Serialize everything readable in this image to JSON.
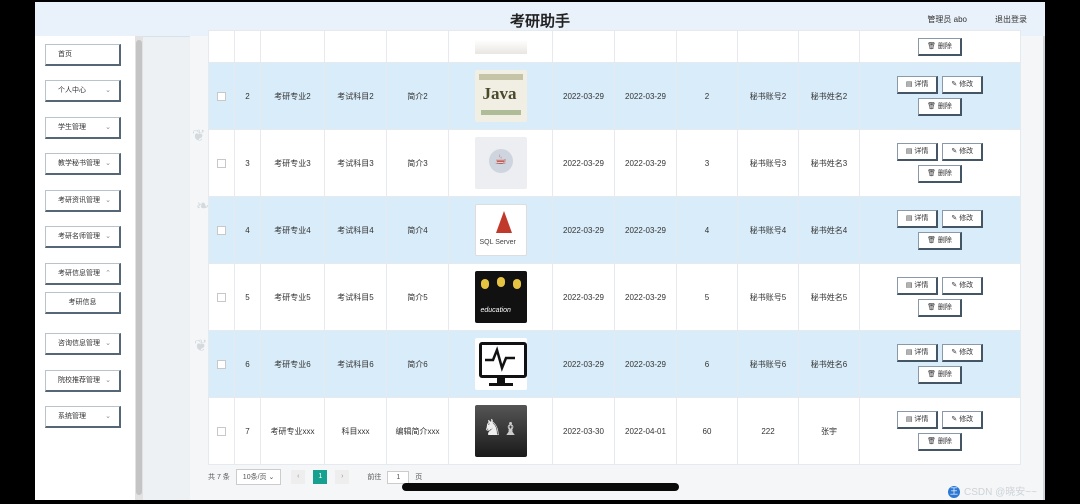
{
  "header": {
    "title": "考研助手",
    "admin_label": "管理员 abo",
    "logout": "退出登录"
  },
  "sidebar": {
    "items": [
      {
        "label": "首页",
        "chev": false
      },
      {
        "label": "个人中心",
        "chev": true
      },
      {
        "label": "学生管理",
        "chev": true
      },
      {
        "label": "教学秘书管理",
        "chev": true
      },
      {
        "label": "考研资讯管理",
        "chev": true
      },
      {
        "label": "考研名师管理",
        "chev": true
      },
      {
        "label": "考研信息管理",
        "chev": true
      },
      {
        "label": "考研信息",
        "chev": false
      },
      {
        "label": "咨询信息管理",
        "chev": true
      },
      {
        "label": "院校推荐管理",
        "chev": true
      },
      {
        "label": "系统管理",
        "chev": true
      }
    ]
  },
  "table": {
    "actions": {
      "detail": "详情",
      "edit": "修改",
      "delete": "删除"
    },
    "rows": [
      {
        "no": "2",
        "major": "考研专业2",
        "subject": "考试科目2",
        "intro": "简介2",
        "img": "java-icon",
        "start": "2022-03-29",
        "end": "2022-03-29",
        "num": "2",
        "account": "秘书账号2",
        "name": "秘书姓名2",
        "cls": "hl"
      },
      {
        "no": "3",
        "major": "考研专业3",
        "subject": "考试科目3",
        "intro": "简介3",
        "img": "java-cup-icon",
        "start": "2022-03-29",
        "end": "2022-03-29",
        "num": "3",
        "account": "秘书账号3",
        "name": "秘书姓名3",
        "cls": "wt"
      },
      {
        "no": "4",
        "major": "考研专业4",
        "subject": "考试科目4",
        "intro": "简介4",
        "img": "sql-server-icon",
        "start": "2022-03-29",
        "end": "2022-03-29",
        "num": "4",
        "account": "秘书账号4",
        "name": "秘书姓名4",
        "cls": "hl"
      },
      {
        "no": "5",
        "major": "考研专业5",
        "subject": "考试科目5",
        "intro": "简介5",
        "img": "education-icon",
        "start": "2022-03-29",
        "end": "2022-03-29",
        "num": "5",
        "account": "秘书账号5",
        "name": "秘书姓名5",
        "cls": "wt"
      },
      {
        "no": "6",
        "major": "考研专业6",
        "subject": "考试科目6",
        "intro": "简介6",
        "img": "monitor-icon",
        "start": "2022-03-29",
        "end": "2022-03-29",
        "num": "6",
        "account": "秘书账号6",
        "name": "秘书姓名6",
        "cls": "hl"
      },
      {
        "no": "7",
        "major": "考研专业xxx",
        "subject": "科目xxx",
        "intro": "编辑简介xxx",
        "img": "chess-icon",
        "start": "2022-03-30",
        "end": "2022-04-01",
        "num": "60",
        "account": "222",
        "name": "张宇",
        "cls": "wt"
      }
    ]
  },
  "pager": {
    "total": "共 7 条",
    "page_size": "10条/页",
    "prev": "‹",
    "current": "1",
    "next": "›",
    "goto_label": "前往",
    "goto_value": "1",
    "page_unit": "页"
  },
  "watermark": {
    "logo": "王",
    "text": "CSDN @晓安~~"
  }
}
